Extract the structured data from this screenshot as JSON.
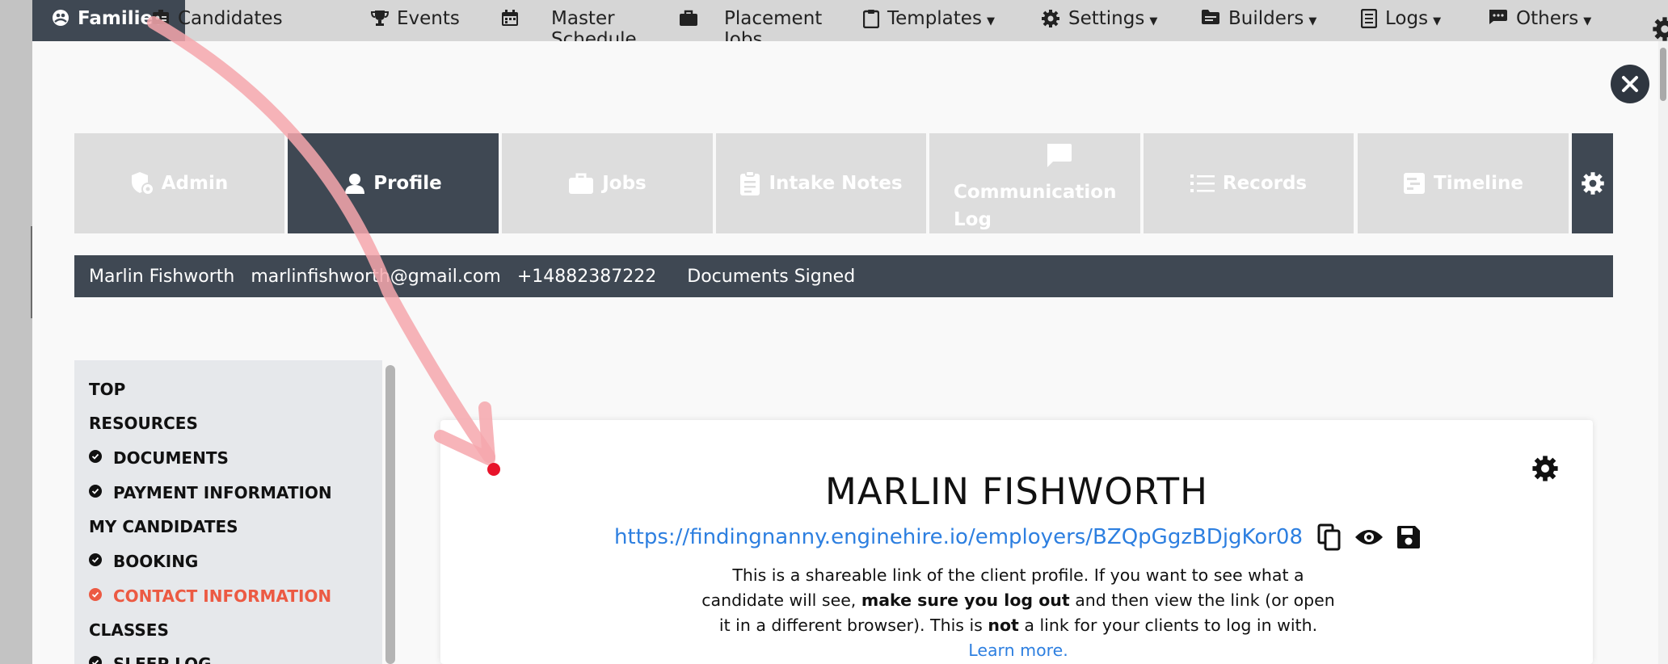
{
  "topnav": {
    "items": [
      {
        "label": "Families",
        "icon": "families-icon"
      },
      {
        "label": "Candidates",
        "icon": "candidates-icon"
      },
      {
        "label": "Events",
        "icon": "trophy-icon"
      },
      {
        "label": "Master Schedule",
        "icon": "calendar-icon"
      },
      {
        "label": "Placement Jobs",
        "icon": "briefcase-icon"
      },
      {
        "label": "Templates",
        "icon": "clipboard-icon"
      },
      {
        "label": "Settings",
        "icon": "gear-icon"
      },
      {
        "label": "Builders",
        "icon": "folder-icon"
      },
      {
        "label": "Logs",
        "icon": "log-icon"
      },
      {
        "label": "Others",
        "icon": "message-icon"
      }
    ]
  },
  "tabs": [
    {
      "label": "Admin",
      "icon": "admin-icon"
    },
    {
      "label": "Profile",
      "icon": "user-icon"
    },
    {
      "label": "Jobs",
      "icon": "briefcase-icon"
    },
    {
      "label": "Intake Notes",
      "icon": "clipboard-icon"
    },
    {
      "label": "Communication Log",
      "icon": "comment-icon"
    },
    {
      "label": "Records",
      "icon": "list-icon"
    },
    {
      "label": "Timeline",
      "icon": "timeline-icon"
    }
  ],
  "infobar": {
    "name": "Marlin Fishworth",
    "email": "marlinfishworth@gmail.com",
    "phone": "+14882387222",
    "status": "Documents Signed"
  },
  "sidenav": {
    "items": [
      {
        "label": "TOP",
        "checked": false
      },
      {
        "label": "RESOURCES",
        "checked": false
      },
      {
        "label": "DOCUMENTS",
        "checked": true
      },
      {
        "label": "PAYMENT INFORMATION",
        "checked": true
      },
      {
        "label": "MY CANDIDATES",
        "checked": false
      },
      {
        "label": "BOOKING",
        "checked": true
      },
      {
        "label": "CONTACT INFORMATION",
        "checked": true,
        "color": "#ec5a43"
      },
      {
        "label": "CLASSES",
        "checked": false
      },
      {
        "label": "SLEEP LOG",
        "checked": true
      }
    ]
  },
  "profile": {
    "name": "MARLIN FISHWORTH",
    "link": "https://findingnanny.enginehire.io/employers/BZQpGgzBDjgKor08",
    "desc_part1": "This is a shareable link of the client profile. If you want to see what a candidate will see, ",
    "desc_bold1": "make sure you log out",
    "desc_part2": " and then view the link (or open it in a different browser). This is ",
    "desc_bold2": "not",
    "desc_part3": " a link for your clients to log in with. ",
    "learn_more": "Learn more."
  },
  "colors": {
    "dark": "#3f4853",
    "tab_inactive": "#dddddd",
    "link": "#2d7fe0",
    "alert": "#ec5a43",
    "annotation": "#f6a7ad",
    "annotation_dot": "#e8132a"
  }
}
